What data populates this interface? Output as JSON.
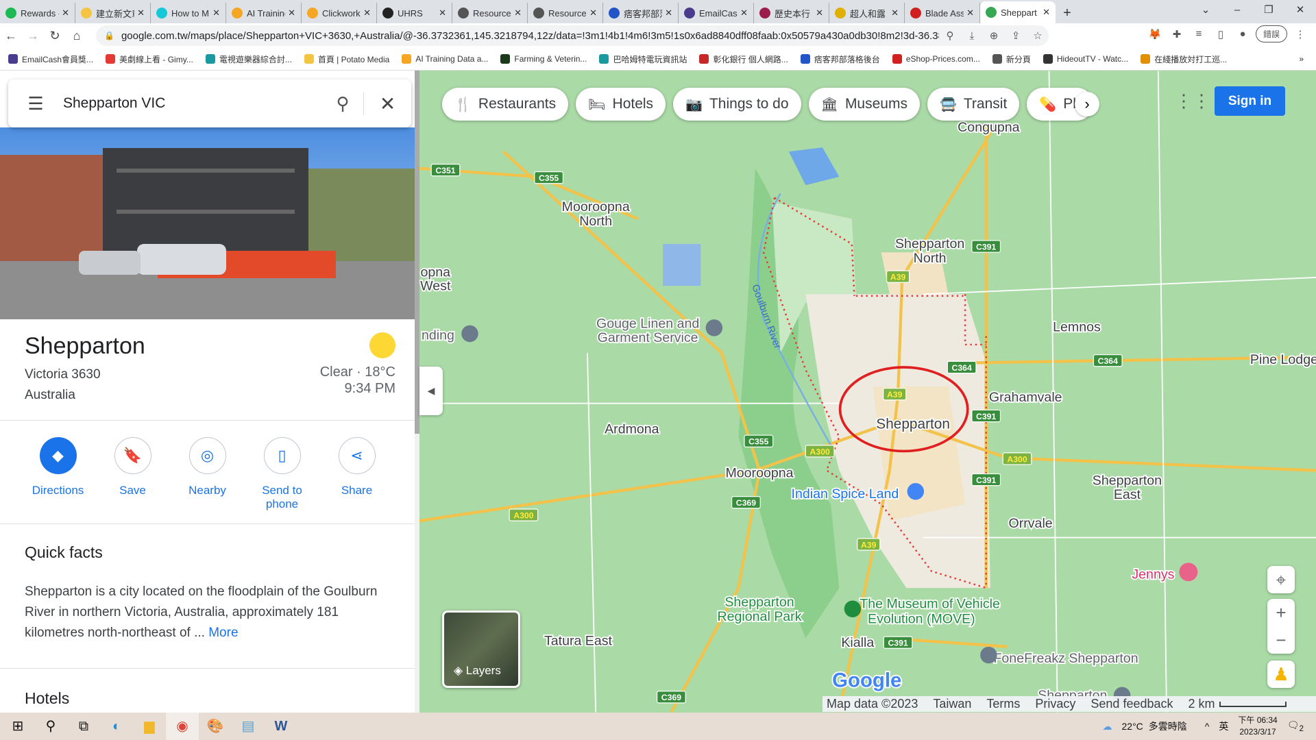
{
  "browser": {
    "tabs": [
      {
        "label": "Rewards -",
        "color": "#1db954"
      },
      {
        "label": "建立新文章",
        "color": "#f4c542"
      },
      {
        "label": "How to M",
        "color": "#16c8d8"
      },
      {
        "label": "AI Training",
        "color": "#f5a623"
      },
      {
        "label": "Clickwork",
        "color": "#f5a623"
      },
      {
        "label": "UHRS",
        "color": "#222222"
      },
      {
        "label": "Resource",
        "color": "#555555"
      },
      {
        "label": "Resource",
        "color": "#555555"
      },
      {
        "label": "痞客邦部落",
        "color": "#2355c8"
      },
      {
        "label": "EmailCash",
        "color": "#4a3b8c"
      },
      {
        "label": "歷史本行",
        "color": "#9c1c4b"
      },
      {
        "label": "超人和露",
        "color": "#e0b000"
      },
      {
        "label": "Blade Ass",
        "color": "#d02020"
      },
      {
        "label": "Sheppart",
        "color": "#34a853",
        "active": true
      }
    ],
    "new_tab": "+",
    "url": "google.com.tw/maps/place/Shepparton+VIC+3630,+Australia/@-36.3732361,145.3218794,12z/data=!3m1!4b1!4m6!3m5!1s0x6ad8840dff08faab:0x50579a430a0db30!8m2!3d-36.3821418!4d145.40722...",
    "profile_button": "錯誤",
    "bookmarks": [
      {
        "label": "EmailCash會員獎...",
        "color": "#4a3b8c"
      },
      {
        "label": "美劇線上看 - Gimy...",
        "color": "#e53935"
      },
      {
        "label": "電視遊樂器綜合討...",
        "color": "#1a9aa0"
      },
      {
        "label": "首頁 | Potato Media",
        "color": "#f4c542"
      },
      {
        "label": "AI Training Data a...",
        "color": "#f5a623"
      },
      {
        "label": "Farming & Veterin...",
        "color": "#1b3a1b"
      },
      {
        "label": "巴哈姆特電玩資訊站",
        "color": "#1a9aa0"
      },
      {
        "label": "彰化銀行 個人網路...",
        "color": "#c62828"
      },
      {
        "label": "痞客邦部落格後台",
        "color": "#2355c8"
      },
      {
        "label": "eShop-Prices.com...",
        "color": "#d02020"
      },
      {
        "label": "新分頁",
        "color": "#555555"
      },
      {
        "label": "HideoutTV - Watc...",
        "color": "#333333"
      },
      {
        "label": "在綫播放対打工巡...",
        "color": "#e09000"
      }
    ],
    "bookmarks_more": "»"
  },
  "search": {
    "query": "Shepparton VIC"
  },
  "place": {
    "name": "Shepparton",
    "region": "Victoria 3630",
    "country": "Australia",
    "weather": "Clear · 18°C",
    "time": "9:34 PM",
    "actions": [
      {
        "label": "Directions",
        "icon": "directions-icon",
        "glyph": "◆"
      },
      {
        "label": "Save",
        "icon": "bookmark-icon",
        "glyph": "🔖"
      },
      {
        "label": "Nearby",
        "icon": "nearby-icon",
        "glyph": "◎"
      },
      {
        "label": "Send to\nphone",
        "icon": "phone-icon",
        "glyph": "▯"
      },
      {
        "label": "Share",
        "icon": "share-icon",
        "glyph": "⋖"
      }
    ],
    "quick_facts_title": "Quick facts",
    "description": "Shepparton is a city located on the floodplain of the Goulburn River in northern Victoria, Australia, approximately 181 kilometres north-northeast of ...",
    "more": "More",
    "hotels_title": "Hotels"
  },
  "map": {
    "chips": [
      {
        "label": "Restaurants",
        "glyph": "🍴"
      },
      {
        "label": "Hotels",
        "glyph": "🛏"
      },
      {
        "label": "Things to do",
        "glyph": "📷"
      },
      {
        "label": "Museums",
        "glyph": "🏛"
      },
      {
        "label": "Transit",
        "glyph": "🚍"
      },
      {
        "label": "Ph",
        "glyph": "💊"
      }
    ],
    "sign_in": "Sign in",
    "layers": "Layers",
    "labels": {
      "congupna": "Congupna",
      "mooroopna_north_1": "Mooroopna",
      "mooroopna_north_2": "North",
      "west_1": "opna",
      "west_2": "West",
      "shep_north_1": "Shepparton",
      "shep_north_2": "North",
      "lemnos": "Lemnos",
      "pine_lodge": "Pine Lodge",
      "gouge_1": "Gouge Linen and",
      "gouge_2": "Garment Service",
      "nding": "nding",
      "grahamvale": "Grahamvale",
      "shepparton": "Shepparton",
      "ardmona": "Ardmona",
      "mooroopna": "Mooroopna",
      "indian": "Indian Spice Land",
      "shep_east_1": "Shepparton",
      "shep_east_2": "East",
      "orrvale": "Orrvale",
      "jennys": "Jennys",
      "park_1": "Shepparton",
      "park_2": "Regional Park",
      "move_1": "The Museum of Vehicle",
      "move_2": "Evolution (MOVE)",
      "tatura": "Tatura East",
      "kialla": "Kialla",
      "fonefreakz": "FoneFreakz Shepparton",
      "shep_bottom": "Shepparton",
      "river": "Goulburn River"
    },
    "shields": [
      "C351",
      "C355",
      "C391",
      "A39",
      "C364",
      "C364",
      "A39",
      "C391",
      "C355",
      "A300",
      "A300",
      "C391",
      "C369",
      "A300",
      "A39",
      "C391",
      "C369"
    ],
    "footer": {
      "data": "Map data ©2023",
      "region": "Taiwan",
      "terms": "Terms",
      "privacy": "Privacy",
      "feedback": "Send feedback",
      "scale": "2 km"
    },
    "highlight_color": "#e02020"
  },
  "taskbar": {
    "weather": "22°C",
    "condition": "多雲時陰",
    "ime": "英",
    "time": "下午 06:34",
    "date": "2023/3/17",
    "notifications": "2"
  }
}
